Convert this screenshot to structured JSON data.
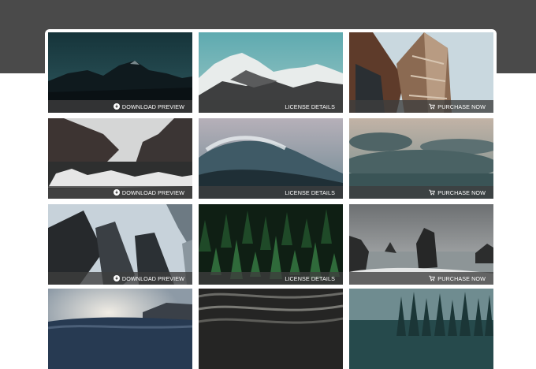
{
  "gallery": {
    "tiles": [
      {
        "action": "DOWNLOAD PREVIEW",
        "icon": "download-circle-icon"
      },
      {
        "action": "LICENSE DETAILS",
        "icon": ""
      },
      {
        "action": "PURCHASE NOW",
        "icon": "cart-icon"
      },
      {
        "action": "DOWNLOAD PREVIEW",
        "icon": "download-circle-icon"
      },
      {
        "action": "LICENSE DETAILS",
        "icon": ""
      },
      {
        "action": "PURCHASE NOW",
        "icon": "cart-icon"
      },
      {
        "action": "DOWNLOAD PREVIEW",
        "icon": "download-circle-icon"
      },
      {
        "action": "LICENSE DETAILS",
        "icon": ""
      },
      {
        "action": "PURCHASE NOW",
        "icon": "cart-icon"
      },
      {
        "action": "",
        "icon": ""
      },
      {
        "action": "",
        "icon": ""
      },
      {
        "action": "",
        "icon": ""
      }
    ]
  },
  "colors": {
    "header_band": "#4a4a4a",
    "caption_bar": "#3e3e3e",
    "page_bg": "#ffffff"
  }
}
